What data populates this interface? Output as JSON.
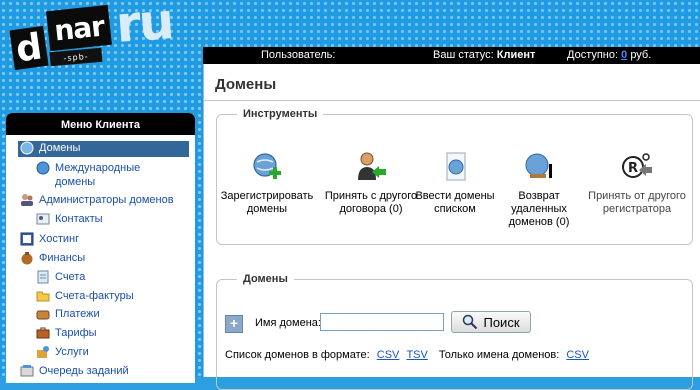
{
  "logo": {
    "d": "d",
    "nar": "nar",
    "sub": "-spb-",
    "ru": "ru"
  },
  "status": {
    "user_label": "Пользователь:",
    "status_label": "Ваш статус:",
    "status_value": "Клиент",
    "available_label": "Доступно:",
    "balance": "0",
    "currency": "руб."
  },
  "page": {
    "title": "Домены"
  },
  "tools": {
    "legend": "Инструменты",
    "items": [
      {
        "label": "Зарегистрировать домены",
        "icon": "globe-plus-icon",
        "enabled": true
      },
      {
        "label": "Принять с другого договора (0)",
        "icon": "user-arrow-icon",
        "enabled": true
      },
      {
        "label": "Ввести домены списком",
        "icon": "document-globe-icon",
        "enabled": true
      },
      {
        "label": "Возврат удаленных доменов (0)",
        "icon": "globe-restore-icon",
        "enabled": true
      },
      {
        "label": "Принять от другого регистратора",
        "icon": "registrar-transfer-icon",
        "enabled": false
      }
    ]
  },
  "domains": {
    "legend": "Домены",
    "plus": "+",
    "field_label": "Имя домена:",
    "input_value": "",
    "search_label": "Поиск",
    "export_label": "Список доменов в формате:",
    "csv": "CSV",
    "tsv": "TSV",
    "names_only_label": "Только имена доменов:",
    "names_csv": "CSV"
  },
  "menu": {
    "header": "Меню Клиента",
    "items": [
      {
        "label": "Домены",
        "icon": "globe-icon",
        "active": true
      },
      {
        "label": "Международные домены",
        "icon": "globe-icon",
        "sub": true
      },
      {
        "label": "Администраторы доменов",
        "icon": "users-icon"
      },
      {
        "label": "Контакты",
        "icon": "contact-card-icon",
        "sub": true
      },
      {
        "label": "Хостинг",
        "icon": "book-icon"
      },
      {
        "label": "Финансы",
        "icon": "money-bag-icon"
      },
      {
        "label": "Счета",
        "icon": "invoice-icon",
        "sub": true
      },
      {
        "label": "Счета-фактуры",
        "icon": "folder-icon",
        "sub": true
      },
      {
        "label": "Платежи",
        "icon": "wallet-icon",
        "sub": true
      },
      {
        "label": "Тарифы",
        "icon": "briefcase-icon",
        "sub": true
      },
      {
        "label": "Услуги",
        "icon": "services-icon",
        "sub": true
      },
      {
        "label": "Очередь заданий",
        "icon": "queue-icon"
      }
    ]
  },
  "colors": {
    "accent_blue": "#1f9be3",
    "menu_active": "#336699",
    "link": "#1a55c0"
  }
}
